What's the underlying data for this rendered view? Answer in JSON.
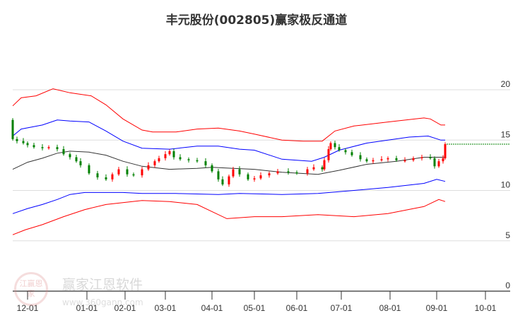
{
  "chart_data": {
    "type": "candlestick",
    "title": "丰元股份(002805)赢家极反通道",
    "xlabel": "",
    "ylabel": "",
    "ylim": [
      0,
      20
    ],
    "grid": true,
    "y_ticks": [
      "20",
      "15",
      "10",
      "5",
      "0"
    ],
    "y_tick_values": [
      20,
      15,
      10,
      5,
      0
    ],
    "x_ticks": [
      {
        "label": "12-01",
        "idx": 7
      },
      {
        "label": "01-01",
        "idx": 35
      },
      {
        "label": "02-01",
        "idx": 53
      },
      {
        "label": "03-01",
        "idx": 72
      },
      {
        "label": "04-01",
        "idx": 94
      },
      {
        "label": "05-01",
        "idx": 114
      },
      {
        "label": "06-01",
        "idx": 134
      },
      {
        "label": "07-01",
        "idx": 155
      },
      {
        "label": "08-01",
        "idx": 178
      },
      {
        "label": "09-01",
        "idx": 200
      },
      {
        "label": "10-01",
        "idx": 223
      }
    ],
    "xlim_idx": [
      0,
      235
    ],
    "first_open": 17.0,
    "closes": [
      [
        0,
        15.1
      ],
      [
        2,
        14.9
      ],
      [
        5,
        14.7
      ],
      [
        7,
        14.5
      ],
      [
        10,
        14.3
      ],
      [
        14,
        14.2
      ],
      [
        17,
        14.3
      ],
      [
        21,
        14.1
      ],
      [
        24,
        13.6
      ],
      [
        27,
        13.3
      ],
      [
        30,
        12.9
      ],
      [
        32,
        12.5
      ],
      [
        36,
        11.7
      ],
      [
        40,
        11.3
      ],
      [
        44,
        11.1
      ],
      [
        47,
        11.6
      ],
      [
        50,
        12.1
      ],
      [
        54,
        11.6
      ],
      [
        57,
        11.5
      ],
      [
        61,
        12.1
      ],
      [
        64,
        12.5
      ],
      [
        67,
        12.9
      ],
      [
        69,
        13.2
      ],
      [
        72,
        13.6
      ],
      [
        74,
        13.9
      ],
      [
        76,
        13.3
      ],
      [
        79,
        13.1
      ],
      [
        83,
        13.0
      ],
      [
        87,
        12.9
      ],
      [
        91,
        12.5
      ],
      [
        94,
        11.9
      ],
      [
        97,
        11.1
      ],
      [
        99,
        10.6
      ],
      [
        102,
        11.4
      ],
      [
        104,
        12.1
      ],
      [
        107,
        11.6
      ],
      [
        111,
        11.1
      ],
      [
        114,
        11.2
      ],
      [
        117,
        11.5
      ],
      [
        121,
        11.7
      ],
      [
        125,
        11.9
      ],
      [
        130,
        11.8
      ],
      [
        134,
        11.7
      ],
      [
        139,
        12.1
      ],
      [
        142,
        12.3
      ],
      [
        146,
        12.1
      ],
      [
        147,
        13.0
      ],
      [
        149,
        14.1
      ],
      [
        150,
        14.7
      ],
      [
        152,
        14.3
      ],
      [
        154,
        14.0
      ],
      [
        157,
        13.8
      ],
      [
        160,
        13.5
      ],
      [
        164,
        13.1
      ],
      [
        167,
        12.9
      ],
      [
        170,
        13.0
      ],
      [
        174,
        13.1
      ],
      [
        177,
        13.2
      ],
      [
        181,
        13.0
      ],
      [
        185,
        13.0
      ],
      [
        189,
        13.2
      ],
      [
        193,
        13.3
      ],
      [
        197,
        13.2
      ],
      [
        199,
        12.4
      ],
      [
        201,
        12.9
      ],
      [
        203,
        13.2
      ],
      [
        204,
        14.6
      ]
    ],
    "series": [
      {
        "name": "outer-upper",
        "color": "#ff0000",
        "points": [
          [
            0,
            18.4
          ],
          [
            4,
            19.2
          ],
          [
            11,
            19.4
          ],
          [
            19,
            20.1
          ],
          [
            27,
            19.7
          ],
          [
            37,
            19.4
          ],
          [
            44,
            18.5
          ],
          [
            52,
            17.1
          ],
          [
            61,
            16.0
          ],
          [
            66,
            15.8
          ],
          [
            77,
            15.8
          ],
          [
            87,
            16.1
          ],
          [
            97,
            16.2
          ],
          [
            107,
            15.9
          ],
          [
            114,
            15.6
          ],
          [
            127,
            15.0
          ],
          [
            137,
            14.9
          ],
          [
            146,
            14.9
          ],
          [
            152,
            15.9
          ],
          [
            161,
            16.4
          ],
          [
            177,
            16.8
          ],
          [
            194,
            17.2
          ],
          [
            197,
            17.1
          ],
          [
            202,
            16.5
          ],
          [
            204,
            16.5
          ]
        ]
      },
      {
        "name": "inner-upper",
        "color": "#0000ff",
        "points": [
          [
            0,
            15.4
          ],
          [
            4,
            16.1
          ],
          [
            14,
            16.5
          ],
          [
            21,
            17.0
          ],
          [
            27,
            16.9
          ],
          [
            36,
            16.8
          ],
          [
            44,
            15.9
          ],
          [
            52,
            14.9
          ],
          [
            61,
            14.2
          ],
          [
            74,
            14.1
          ],
          [
            87,
            14.4
          ],
          [
            97,
            14.4
          ],
          [
            107,
            14.1
          ],
          [
            114,
            14.0
          ],
          [
            127,
            13.1
          ],
          [
            141,
            12.9
          ],
          [
            147,
            13.3
          ],
          [
            154,
            14.0
          ],
          [
            167,
            14.7
          ],
          [
            187,
            15.3
          ],
          [
            196,
            15.4
          ],
          [
            202,
            15.0
          ],
          [
            204,
            15.0
          ]
        ]
      },
      {
        "name": "middle",
        "color": "#333333",
        "points": [
          [
            0,
            12.1
          ],
          [
            7,
            12.8
          ],
          [
            14,
            13.2
          ],
          [
            21,
            13.7
          ],
          [
            27,
            13.9
          ],
          [
            36,
            13.8
          ],
          [
            44,
            13.5
          ],
          [
            52,
            12.9
          ],
          [
            61,
            12.4
          ],
          [
            74,
            12.1
          ],
          [
            87,
            12.2
          ],
          [
            94,
            12.3
          ],
          [
            104,
            12.2
          ],
          [
            114,
            12.1
          ],
          [
            127,
            11.8
          ],
          [
            144,
            11.6
          ],
          [
            154,
            12.0
          ],
          [
            167,
            12.6
          ],
          [
            181,
            12.9
          ],
          [
            194,
            13.3
          ],
          [
            204,
            13.3
          ]
        ]
      },
      {
        "name": "inner-lower",
        "color": "#0000ff",
        "points": [
          [
            0,
            7.7
          ],
          [
            7,
            8.2
          ],
          [
            14,
            8.6
          ],
          [
            21,
            9.1
          ],
          [
            27,
            9.6
          ],
          [
            34,
            9.8
          ],
          [
            41,
            9.8
          ],
          [
            52,
            9.8
          ],
          [
            61,
            9.7
          ],
          [
            77,
            9.7
          ],
          [
            97,
            9.6
          ],
          [
            107,
            9.7
          ],
          [
            127,
            9.6
          ],
          [
            144,
            9.7
          ],
          [
            161,
            10.0
          ],
          [
            177,
            10.3
          ],
          [
            194,
            10.7
          ],
          [
            200,
            11.1
          ],
          [
            204,
            10.9
          ]
        ]
      },
      {
        "name": "outer-lower",
        "color": "#ff0000",
        "points": [
          [
            0,
            5.6
          ],
          [
            6,
            6.1
          ],
          [
            14,
            6.6
          ],
          [
            24,
            7.4
          ],
          [
            34,
            8.1
          ],
          [
            44,
            8.6
          ],
          [
            61,
            9.0
          ],
          [
            74,
            8.9
          ],
          [
            87,
            8.6
          ],
          [
            94,
            7.9
          ],
          [
            101,
            7.2
          ],
          [
            114,
            7.4
          ],
          [
            127,
            7.4
          ],
          [
            144,
            7.6
          ],
          [
            161,
            7.4
          ],
          [
            177,
            7.7
          ],
          [
            194,
            8.4
          ],
          [
            201,
            9.1
          ],
          [
            204,
            8.9
          ]
        ]
      }
    ],
    "last_price_line": 14.6,
    "colors": {
      "up": "#ff0000",
      "down": "#008000",
      "grid": "#dddddd",
      "axis": "#333333",
      "last_line": "#008000"
    }
  },
  "watermark": {
    "logo_text": "江赢恩家",
    "name": "赢家江恩软件",
    "url": "www.360gann.com"
  }
}
